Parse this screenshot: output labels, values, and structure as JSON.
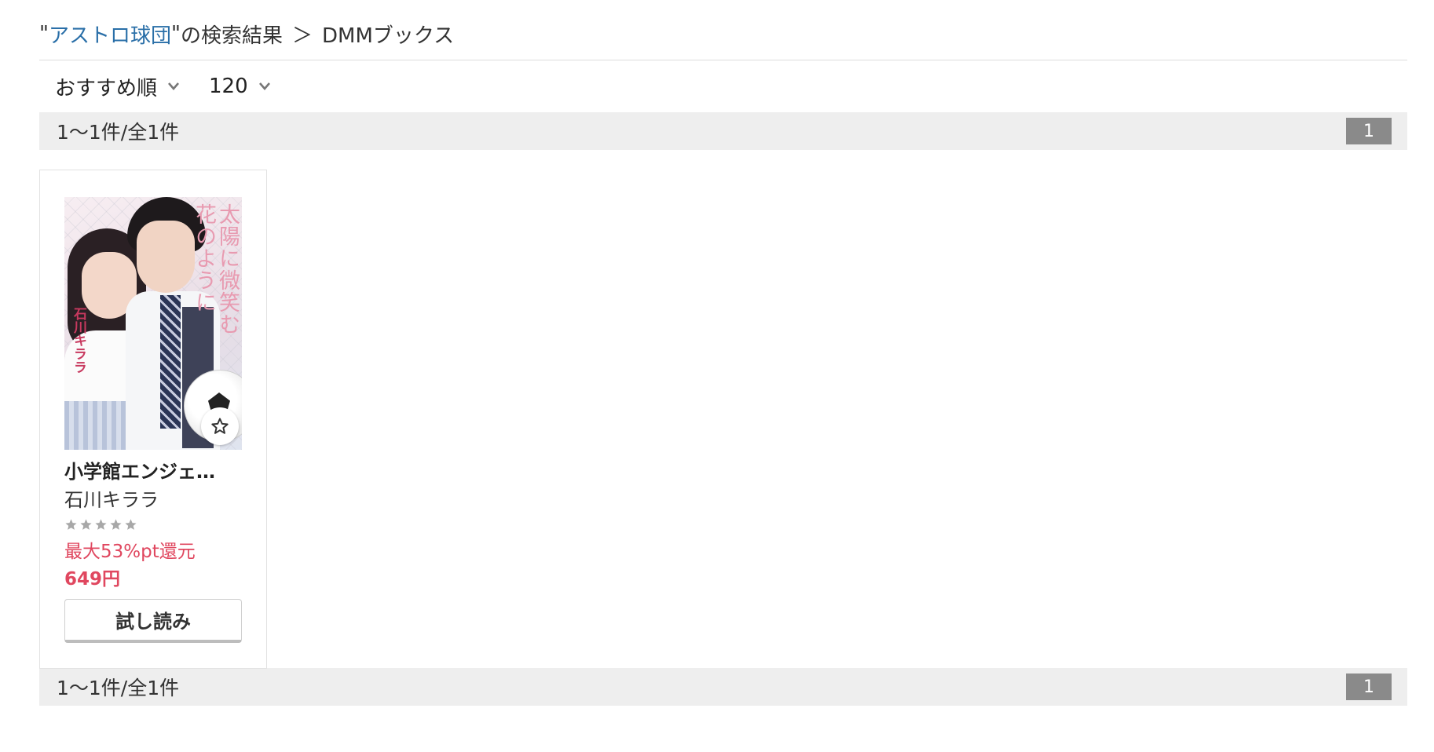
{
  "breadcrumb": {
    "quote_open": "\"",
    "keyword": "アストロ球団",
    "quote_close": "\"",
    "suffix": " の検索結果",
    "separator": "＞",
    "store": "DMMブックス"
  },
  "sort": {
    "order_label": "おすすめ順",
    "per_page": "120"
  },
  "results": {
    "count_top": "1〜1件/全1件",
    "count_bottom": "1〜1件/全1件",
    "page_top": "1",
    "page_bottom": "1"
  },
  "products": [
    {
      "title": "小学館エンジェ…",
      "author": "石川キララ",
      "rating": 0,
      "rating_max": 5,
      "point_back": "最大53%pt還元",
      "price": "649円",
      "trial_label": "試し読み",
      "cover": {
        "title_text": "太陽に微笑む\n花のように",
        "author_text": "石川キララ"
      }
    }
  ],
  "colors": {
    "keyword_link": "#2a6fa8",
    "accent_red": "#e0475f",
    "bar_bg": "#eeeeee",
    "page_btn": "#8a8a8a"
  },
  "icons": {
    "sort_chevron": "chevron-down-icon",
    "favorite": "star-outline-icon",
    "rating_star": "star-icon"
  }
}
